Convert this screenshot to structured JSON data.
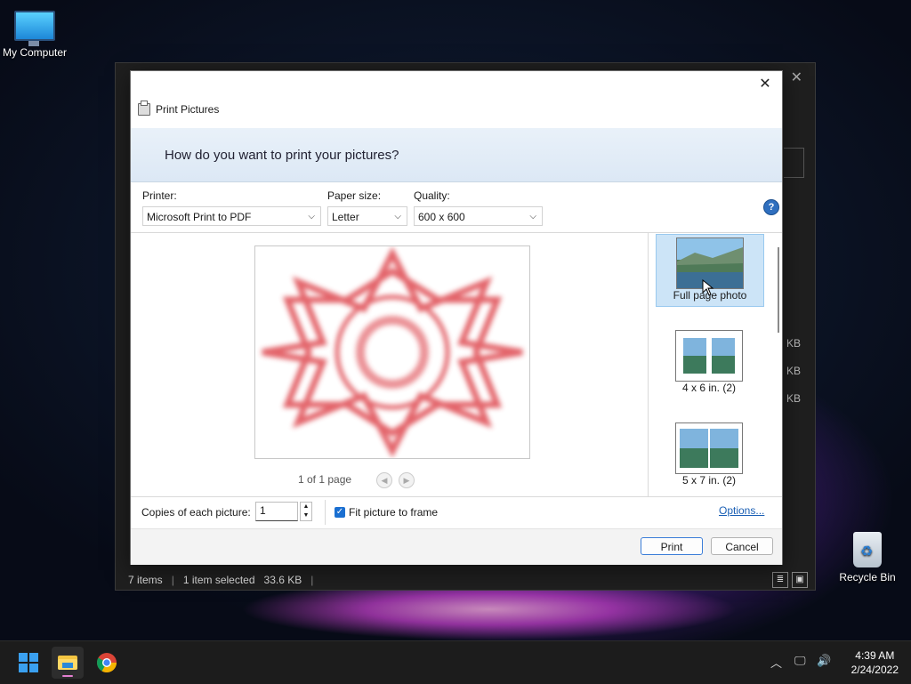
{
  "desktop": {
    "icons": [
      {
        "label": "My Computer",
        "icon": "computer-icon"
      },
      {
        "label": "Recycle Bin",
        "icon": "recycle-bin-icon"
      }
    ]
  },
  "explorer": {
    "status": {
      "items": "7 items",
      "selected": "1 item selected",
      "size": "33.6 KB"
    },
    "sizes": [
      "KB",
      "KB",
      "KB"
    ]
  },
  "dialog": {
    "title": "Print Pictures",
    "heading": "How do you want to print your pictures?",
    "printer": {
      "label": "Printer:",
      "value": "Microsoft Print to PDF"
    },
    "paper_size": {
      "label": "Paper size:",
      "value": "Letter"
    },
    "quality": {
      "label": "Quality:",
      "value": "600 x 600"
    },
    "page_count": "1 of 1 page",
    "layouts": [
      {
        "label": "Full page photo",
        "selected": true
      },
      {
        "label": "4 x 6 in. (2)",
        "selected": false
      },
      {
        "label": "5 x 7 in. (2)",
        "selected": false
      }
    ],
    "copies": {
      "label": "Copies of each picture:",
      "value": "1"
    },
    "fit_to_frame": {
      "label": "Fit picture to frame",
      "checked": true
    },
    "options_link": "Options...",
    "buttons": {
      "print": "Print",
      "cancel": "Cancel"
    }
  },
  "taskbar": {
    "time": "4:39 AM",
    "date": "2/24/2022"
  },
  "colors": {
    "accent": "#1a6fd1",
    "selection": "#cce4f7",
    "preview_pattern": "#e0525a"
  }
}
